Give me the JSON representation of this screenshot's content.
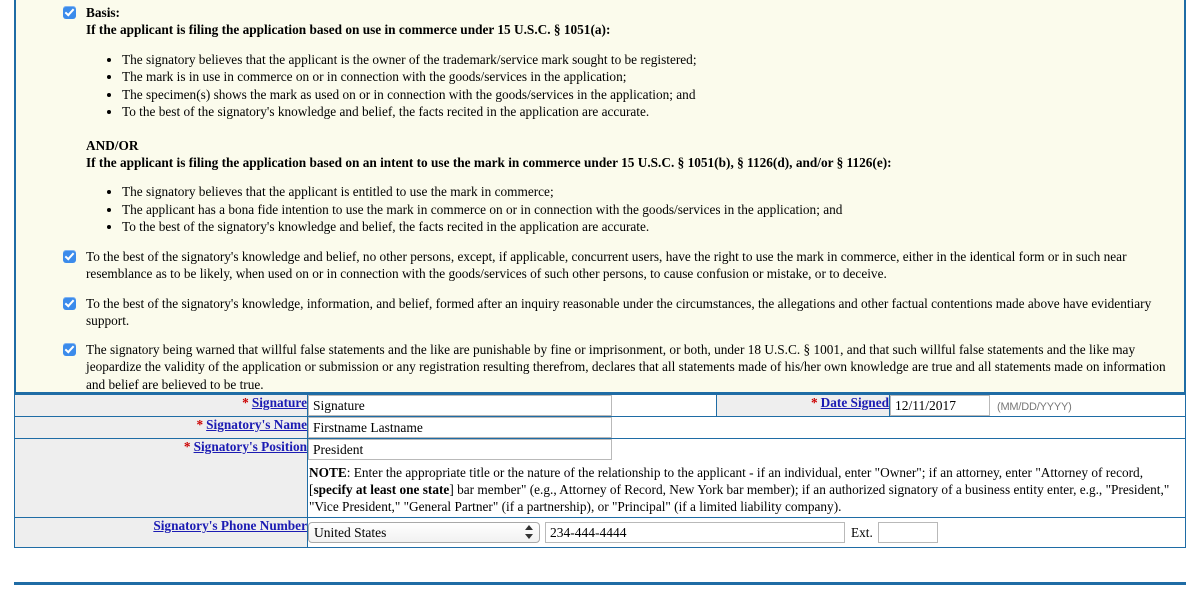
{
  "declaration": {
    "basis": {
      "label": "Basis:",
      "use_heading": "If the applicant is filing the application based on use in commerce under 15 U.S.C. § 1051(a):",
      "use_items": [
        "The signatory believes that the applicant is the owner of the trademark/service mark sought to be registered;",
        "The mark is in use in commerce on or in connection with the goods/services in the application;",
        "The specimen(s) shows the mark as used on or in connection with the goods/services in the application; and",
        "To the best of the signatory's knowledge and belief, the facts recited in the application are accurate."
      ],
      "andor": "AND/OR",
      "itu_heading": "If the applicant is filing the application based on an intent to use the mark in commerce under 15 U.S.C. § 1051(b), § 1126(d), and/or § 1126(e):",
      "itu_items": [
        "The signatory believes that the applicant is entitled to use the mark in commerce;",
        "The applicant has a bona fide intention to use the mark in commerce on or in connection with the goods/services in the application; and",
        "To the best of the signatory's knowledge and belief, the facts recited in the application are accurate."
      ]
    },
    "statements": [
      "To the best of the signatory's knowledge and belief, no other persons, except, if applicable, concurrent users, have the right to use the mark in commerce, either in the identical form or in such near resemblance as to be likely, when used on or in connection with the goods/services of such other persons, to cause confusion or mistake, or to deceive.",
      "To the best of the signatory's knowledge, information, and belief, formed after an inquiry reasonable under the circumstances, the allegations and other factual contentions made above have evidentiary support.",
      "The signatory being warned that willful false statements and the like are punishable by fine or imprisonment, or both, under 18 U.S.C. § 1001, and that such willful false statements and the like may jeopardize the validity of the application or submission or any registration resulting therefrom, declares that all statements made of his/her own knowledge are true and all statements made on information and belief are believed to be true."
    ]
  },
  "form": {
    "required_marker": "*",
    "signature": {
      "label": "Signature",
      "value": "Signature",
      "placeholder": ""
    },
    "date_signed": {
      "label": "Date Signed",
      "value": "12/11/2017",
      "hint": "(MM/DD/YYYY)",
      "placeholder": ""
    },
    "signatory_name": {
      "label": "Signatory's Name",
      "value": "Firstname Lastname",
      "placeholder": ""
    },
    "signatory_position": {
      "label": "Signatory's Position",
      "value": "President",
      "placeholder": "",
      "note_label": "NOTE",
      "note_part1": ": Enter the appropriate title or the nature of the relationship to the applicant - if an individual, enter \"Owner\"; if an attorney, enter \"Attorney of record, [",
      "note_bold": "specify at least one state",
      "note_part2": "] bar member\" (e.g., Attorney of Record, New York bar member); if an authorized signatory of a business entity enter, e.g., \"President,\" \"Vice President,\" \"General Partner\" (if a partnership), or \"Principal\" (if a limited liability company)."
    },
    "signatory_phone": {
      "label": "Signatory's Phone Number",
      "country": "United States",
      "country_options": [
        "United States"
      ],
      "value": "234-444-4444",
      "ext_label": "Ext.",
      "ext_value": "",
      "placeholder": ""
    }
  },
  "colors": {
    "panel_bg": "#fbfbec",
    "border_blue": "#1f6ca5",
    "link_blue": "#1b1bb3",
    "required_red": "#cc0000",
    "checkbox_blue": "#3b8beb",
    "label_bg": "#eeeeee"
  }
}
